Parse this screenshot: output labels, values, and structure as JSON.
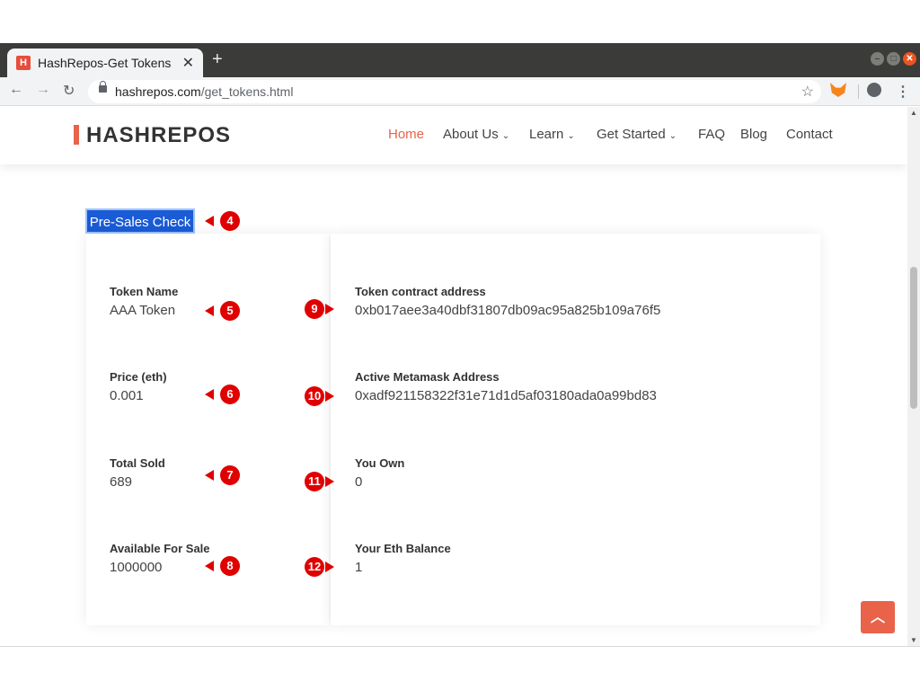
{
  "browser": {
    "tab_title": "HashRepos-Get Tokens",
    "tab_favicon_letter": "H",
    "url_domain": "hashrepos.com",
    "url_path": "/get_tokens.html"
  },
  "site": {
    "logo": "HASHREPOS",
    "nav": [
      {
        "label": "Home",
        "active": true
      },
      {
        "label": "About Us",
        "dropdown": true
      },
      {
        "label": "Learn",
        "dropdown": true
      },
      {
        "label": "Get Started",
        "dropdown": true
      },
      {
        "label": "FAQ"
      },
      {
        "label": "Blog"
      },
      {
        "label": "Contact"
      }
    ]
  },
  "presales": {
    "button_label": "Pre-Sales Check"
  },
  "left_fields": [
    {
      "label": "Token Name",
      "value": "AAA Token"
    },
    {
      "label": "Price (eth)",
      "value": "0.001"
    },
    {
      "label": "Total Sold",
      "value": "689"
    },
    {
      "label": "Available For Sale",
      "value": "1000000"
    }
  ],
  "right_fields": [
    {
      "label": "Token contract address",
      "value": "0xb017aee3a40dbf31807db09ac95a825b109a76f5"
    },
    {
      "label": "Active Metamask Address",
      "value": "0xadf921158322f31e71d1d5af03180ada0a99bd83"
    },
    {
      "label": "You Own",
      "value": "0"
    },
    {
      "label": "Your Eth Balance",
      "value": "1"
    }
  ],
  "markers": {
    "presales": "4",
    "left": [
      "5",
      "6",
      "7",
      "8"
    ],
    "right": [
      "9",
      "10",
      "11",
      "12"
    ]
  },
  "colors": {
    "accent": "#e8634a",
    "button": "#1a5bd6",
    "marker": "#e00000"
  }
}
